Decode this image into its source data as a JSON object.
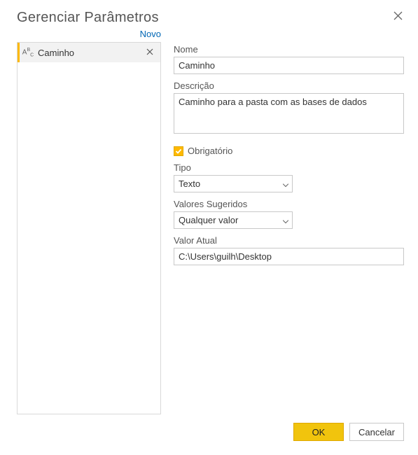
{
  "dialog": {
    "title": "Gerenciar Parâmetros",
    "new_label": "Novo"
  },
  "param_list": {
    "items": [
      {
        "name": "Caminho",
        "type_icon": "ABC"
      }
    ]
  },
  "form": {
    "name_label": "Nome",
    "name_value": "Caminho",
    "desc_label": "Descrição",
    "desc_value": "Caminho para a pasta com as bases de dados",
    "required_label": "Obrigatório",
    "required_checked": true,
    "type_label": "Tipo",
    "type_value": "Texto",
    "suggested_label": "Valores Sugeridos",
    "suggested_value": "Qualquer valor",
    "current_label": "Valor Atual",
    "current_value": "C:\\Users\\guilh\\Desktop"
  },
  "buttons": {
    "ok": "OK",
    "cancel": "Cancelar"
  }
}
